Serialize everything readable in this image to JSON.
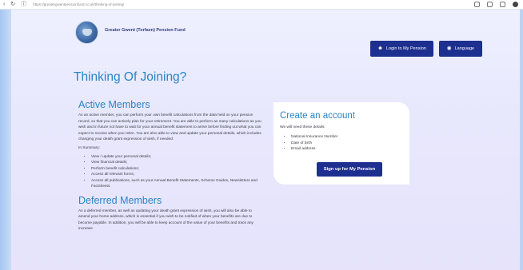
{
  "browser": {
    "url": "https://greatergwentpensionfund.co.uk/thinking-of-joining/"
  },
  "header": {
    "org_name": "Greater Gwent (Torfaen) Pension Fund",
    "login_label": "Login to My Pension",
    "language_label": "Language"
  },
  "page_title": "Thinking Of Joining?",
  "active": {
    "heading": "Active Members",
    "paragraph": "As an active member, you can perform your own benefit calculations from the data held on your pension record, so that you can actively plan for your retirement. You are able to perform as many calculations as you wish and in future not have to wait for your annual benefit statement to arrive before finding out what you can expect to receive when you retire. You are also able to view and update your personal details, which includes changing your death grant expression of wish, if needed.",
    "summary_label": "In Summary:",
    "items": [
      "View / update your personal details;",
      "View financial details;",
      "Perform benefit calculations;",
      "Access all relevant forms;",
      "Access all publications, such as your Annual Benefit Statements, Scheme Guides, Newsletters and Factsheets."
    ]
  },
  "deferred": {
    "heading": "Deferred Members",
    "paragraph": "As a deferred member, as well as updating your death grant expression of wish, you will also be able to amend your home address, which is essential if you wish to be notified of when your benefits are due to become payable. In addition, you will be able to keep account of the value of your benefits and track any increase"
  },
  "card": {
    "heading": "Create an account",
    "lead": "We will need these details:",
    "items": [
      "National Insurance Number",
      "Date of birth",
      "Email address"
    ],
    "button_label": "Sign up for My Pension"
  },
  "colors": {
    "accent": "#2a84c7",
    "button": "#1d2f8f"
  }
}
